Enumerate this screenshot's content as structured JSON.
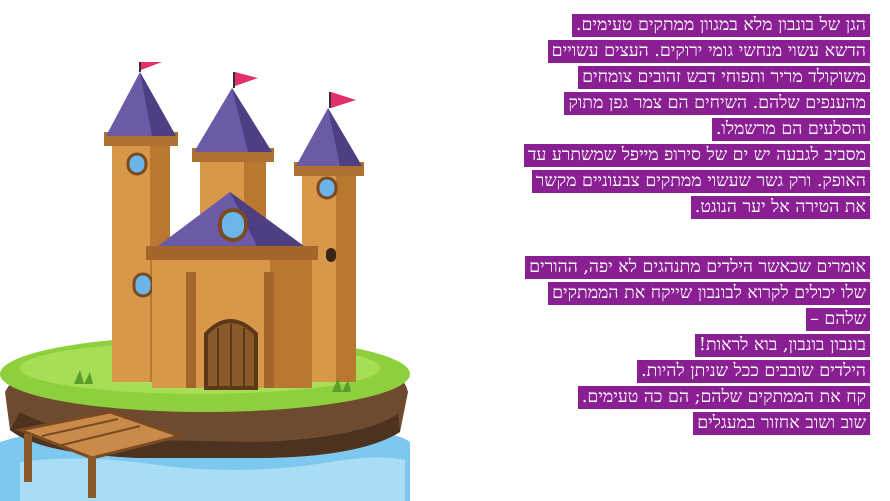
{
  "colors": {
    "highlight": "#8a1f93",
    "text": "#ffffff",
    "background": "#ffffff"
  },
  "illustration": {
    "icon": "castle-on-island-illustration"
  },
  "paragraph1": [
    "הגן של בונבון מלא במגוון ממתקים טעימים.",
    "הדשא עשוי מנחשי גומי ירוקים. העצים עשויים",
    "משוקולד מריר ותפוחי דבש זהובים צומחים",
    "מהענפים שלהם. השיחים הם צמר גפן מתוק",
    "והסלעים הם מרשמלו.",
    "מסביב לגבעה יש ים של סירופ מייפל שמשתרע עד",
    "האופק. ורק גשר שעשוי ממתקים צבעוניים מקשר",
    "את הטירה אל יער הנוגט."
  ],
  "paragraph2": [
    "אומרים שכאשר הילדים מתנהגים לא יפה, ההורים",
    "שלו יכולים לקרוא לבונבון שייקח את הממתקים",
    "שלהם –",
    "בונבון בונבון, בוא לראות!",
    "הילדים שובבים ככל שניתן להיות.",
    "קח את הממתקים שלהם; הם כה טעימים.",
    "שוב ושוב אחזור במעגלים"
  ]
}
